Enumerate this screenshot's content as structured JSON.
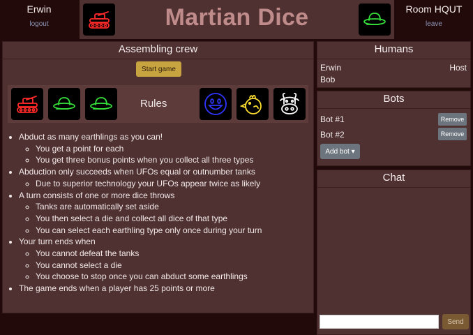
{
  "header": {
    "player_name": "Erwin",
    "logout_label": "logout",
    "room_name": "Room HQUT",
    "leave_label": "leave",
    "title": "Martian Dice"
  },
  "main": {
    "title": "Assembling crew",
    "start_button_label": "Start game",
    "rules_label": "Rules",
    "dice": [
      "tank",
      "ufo",
      "ufo",
      "human",
      "chicken",
      "cow"
    ],
    "rules": [
      {
        "text": "Abduct as many earthlings as you can!",
        "sub": [
          "You get a point for each",
          "You get three bonus points when you collect all three types"
        ]
      },
      {
        "text": "Abduction only succeeds when UFOs equal or outnumber tanks",
        "sub": [
          "Due to superior technology your UFOs appear twice as likely"
        ]
      },
      {
        "text": "A turn consists of one or more dice throws",
        "sub": [
          "Tanks are automatically set aside",
          "You then select a die and collect all dice of that type",
          "You can select each earthling type only once during your turn"
        ]
      },
      {
        "text": "Your turn ends when",
        "sub": [
          "You cannot defeat the tanks",
          "You cannot select a die",
          "You choose to stop once you can abduct some earthlings"
        ]
      },
      {
        "text": "The game ends when a player has 25 points or more",
        "sub": []
      }
    ]
  },
  "humans": {
    "title": "Humans",
    "players": [
      {
        "name": "Erwin",
        "role": "Host"
      },
      {
        "name": "Bob",
        "role": ""
      }
    ]
  },
  "bots": {
    "title": "Bots",
    "items": [
      {
        "name": "Bot #1",
        "remove_label": "Remove"
      },
      {
        "name": "Bot #2",
        "remove_label": "Remove"
      }
    ],
    "add_bot_label": "Add bot ▾"
  },
  "chat": {
    "title": "Chat",
    "input_value": "",
    "send_label": "Send"
  },
  "colors": {
    "tank": "#ff2a2a",
    "ufo": "#35e03a",
    "human": "#2f35ff",
    "chicken": "#ffe030",
    "cow": "#ffffff",
    "accent": "#c8a441"
  }
}
